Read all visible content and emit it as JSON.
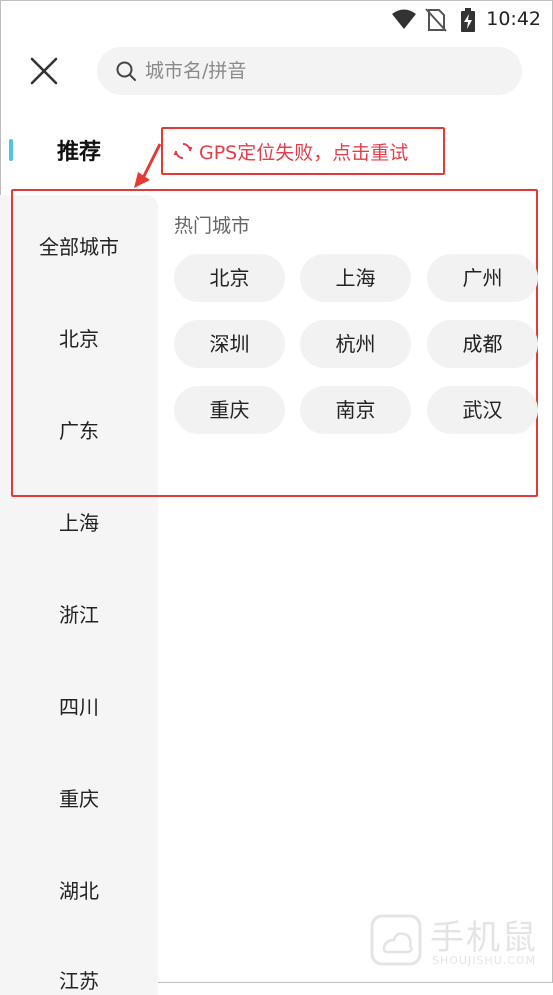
{
  "status_bar": {
    "time": "10:42"
  },
  "search": {
    "placeholder": "城市名/拼音"
  },
  "nav": {
    "recommend_label": "推荐",
    "items": [
      "全部城市",
      "北京",
      "广东",
      "上海",
      "浙江",
      "四川",
      "重庆",
      "湖北",
      "江苏"
    ]
  },
  "gps": {
    "message": "GPS定位失败，点击重试"
  },
  "hot": {
    "title": "热门城市",
    "cities": [
      "北京",
      "上海",
      "广州",
      "深圳",
      "杭州",
      "成都",
      "重庆",
      "南京",
      "武汉"
    ]
  },
  "watermark": {
    "main": "手机鼠",
    "sub": "SHOUJISHU.COM"
  },
  "colors": {
    "accent": "#4fc3e6",
    "alert_red": "#e53935",
    "chip_bg": "#f2f2f2"
  },
  "icons": [
    "wifi-icon",
    "no-sim-icon",
    "battery-charging-icon",
    "close-icon",
    "search-icon",
    "refresh-icon"
  ]
}
